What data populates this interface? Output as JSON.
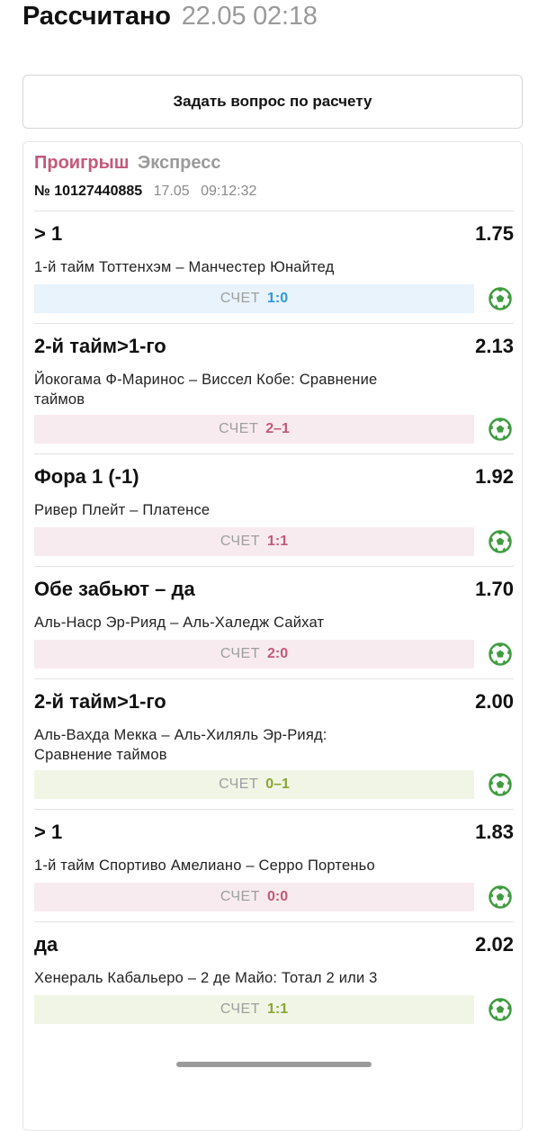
{
  "header": {
    "title": "Рассчитано",
    "datetime": "22.05 02:18"
  },
  "ask_button": {
    "label": "Задать вопрос по расчету"
  },
  "card": {
    "status": "Проигрыш",
    "bet_type": "Экспресс",
    "ticket_number": "№ 10127440885",
    "date": "17.05",
    "time": "09:12:32"
  },
  "score_label": "СЧЕТ",
  "bets": [
    {
      "market": "> 1",
      "odds": "1.75",
      "event": "1-й тайм Тоттенхэм – Манчестер Юнайтед",
      "score": "1:0",
      "result": "blue",
      "icon": "soccer-ball-icon"
    },
    {
      "market": "2-й тайм>1-го",
      "odds": "2.13",
      "event": "Йокогама Ф-Маринос – Виссел Кобе: Сравнение таймов",
      "score": "2–1",
      "result": "pink",
      "icon": "soccer-ball-icon"
    },
    {
      "market": "Фора 1 (-1)",
      "odds": "1.92",
      "event": "Ривер Плейт – Платенсе",
      "score": "1:1",
      "result": "pink",
      "icon": "soccer-ball-icon"
    },
    {
      "market": "Обе забьют – да",
      "odds": "1.70",
      "event": "Аль-Наср Эр-Рияд – Аль-Халедж Сайхат",
      "score": "2:0",
      "result": "pink",
      "icon": "soccer-ball-icon"
    },
    {
      "market": "2-й тайм>1-го",
      "odds": "2.00",
      "event": "Аль-Вахда Мекка – Аль-Хиляль Эр-Рияд: Сравнение таймов",
      "score": "0–1",
      "result": "green",
      "icon": "soccer-ball-icon"
    },
    {
      "market": "> 1",
      "odds": "1.83",
      "event": "1-й тайм Спортиво Амелиано – Серро Портеньо",
      "score": "0:0",
      "result": "pink",
      "icon": "soccer-ball-icon"
    },
    {
      "market": "да",
      "odds": "2.02",
      "event": "Хенераль Кабальеро – 2 де Майо: Тотал 2 или 3",
      "score": "1:1",
      "result": "green",
      "icon": "soccer-ball-icon"
    }
  ],
  "colors": {
    "lost": "#c4587a",
    "won": "#8aa533",
    "neutral": "#2d9ad8",
    "ball": "#3f9c3f"
  }
}
